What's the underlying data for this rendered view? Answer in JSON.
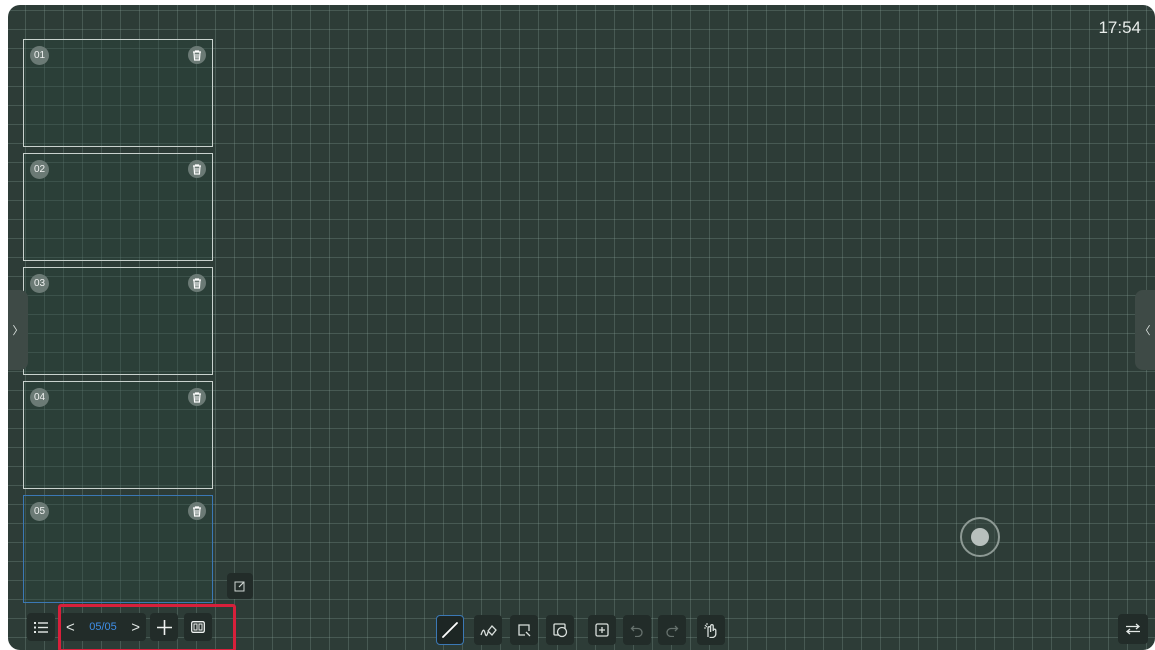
{
  "status": {
    "time": "17:54"
  },
  "pages": [
    {
      "number": "01",
      "active": false
    },
    {
      "number": "02",
      "active": false
    },
    {
      "number": "03",
      "active": false
    },
    {
      "number": "04",
      "active": false
    },
    {
      "number": "05",
      "active": true
    }
  ],
  "pager": {
    "prev": "<",
    "count": "05/05",
    "next": ">"
  },
  "side_tabs": {
    "left": "〉",
    "right": "〈"
  },
  "toolbar": [
    "pen",
    "eraser",
    "lasso-select",
    "shapes",
    "insert",
    "undo",
    "redo",
    "gesture"
  ],
  "colors": {
    "board": "#2d3c37",
    "active_tool": "#3b78b5",
    "pager_count": "#3e8ee8",
    "highlight": "#d8203b"
  }
}
